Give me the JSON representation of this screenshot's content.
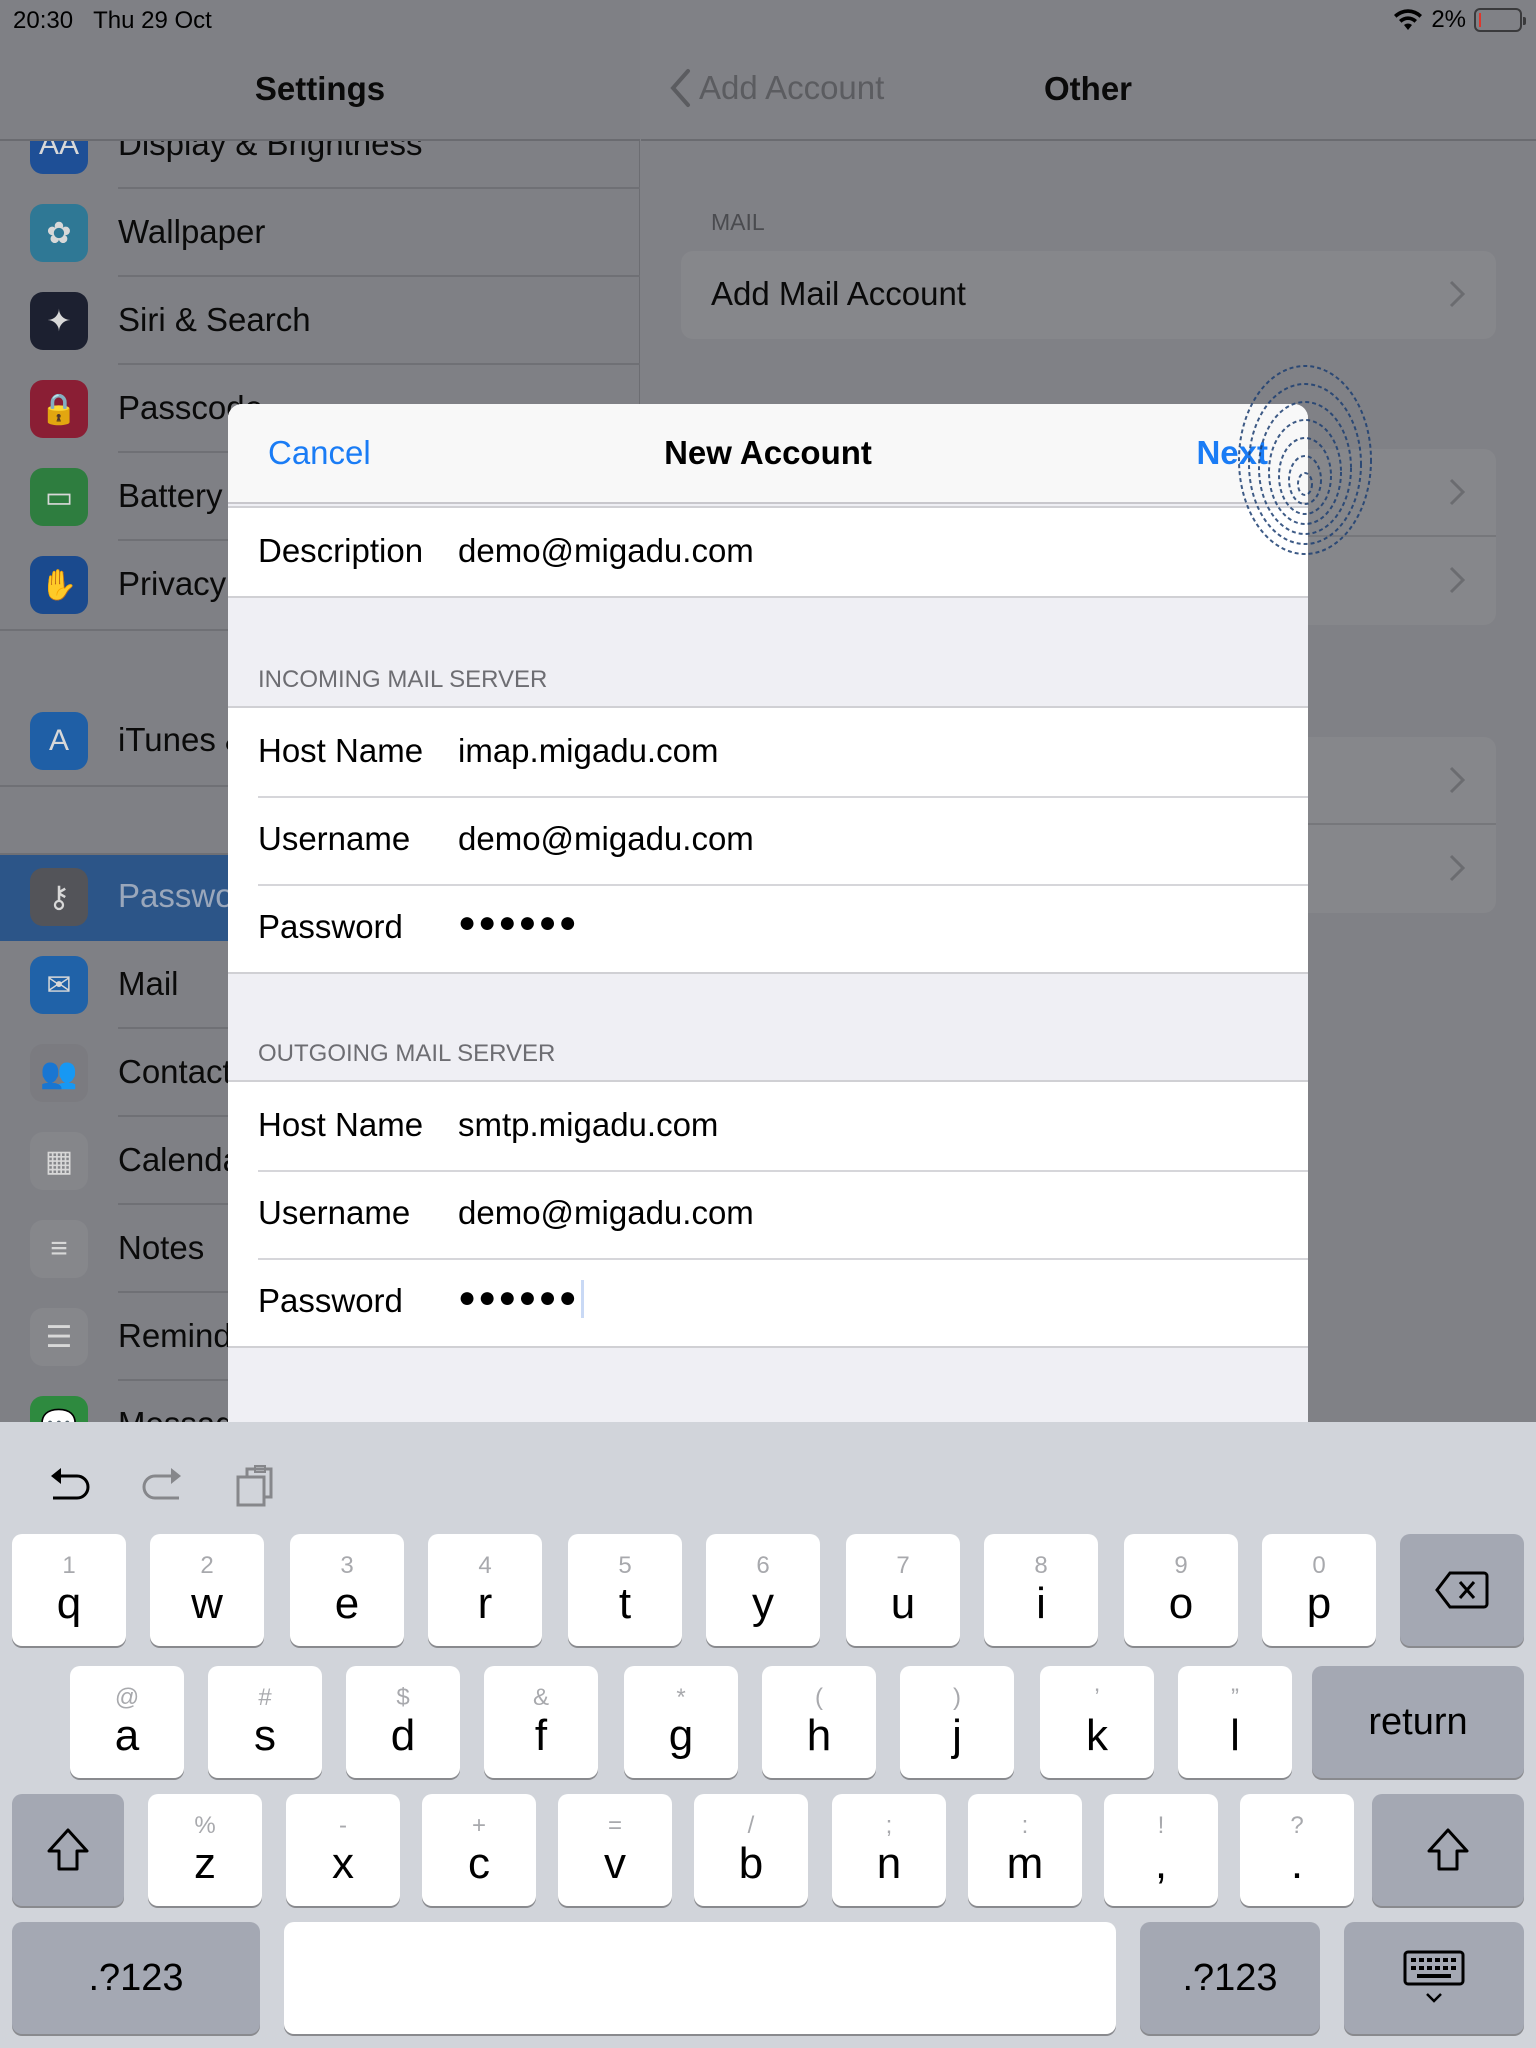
{
  "status_bar": {
    "time": "20:30",
    "date": "Thu 29 Oct",
    "battery": "2%",
    "battery_color": "#e0352b"
  },
  "settings": {
    "title": "Settings",
    "items": [
      {
        "label": "Display & Brightness",
        "icon": "display-brightness-icon",
        "color": "#1e4f96",
        "glyph": "AA"
      },
      {
        "label": "Wallpaper",
        "icon": "wallpaper-icon",
        "color": "#2f7895",
        "glyph": "✿"
      },
      {
        "label": "Siri & Search",
        "icon": "siri-icon",
        "color": "#1c2030",
        "glyph": "✦"
      },
      {
        "label": "Passcode",
        "icon": "lock-icon",
        "color": "#8a1e34",
        "glyph": "🔒"
      },
      {
        "label": "Battery",
        "icon": "battery-icon",
        "color": "#2e7d3f",
        "glyph": "▭"
      },
      {
        "label": "Privacy",
        "icon": "privacy-hand-icon",
        "color": "#1a4a8e",
        "glyph": "✋"
      },
      {
        "label": "iTunes & App Store",
        "icon": "app-store-icon",
        "color": "#1f5fa6",
        "glyph": "A"
      },
      {
        "label": "Passwords & Accounts",
        "icon": "key-icon",
        "color": "#535459",
        "glyph": "⚷",
        "selected": true
      },
      {
        "label": "Mail",
        "icon": "mail-icon",
        "color": "#2062a8",
        "glyph": "✉"
      },
      {
        "label": "Contacts",
        "icon": "contacts-icon",
        "color": "#7b7b80",
        "glyph": "👥"
      },
      {
        "label": "Calendar",
        "icon": "calendar-icon",
        "color": "#85868a",
        "glyph": "▦"
      },
      {
        "label": "Notes",
        "icon": "notes-icon",
        "color": "#86878b",
        "glyph": "≡"
      },
      {
        "label": "Reminders",
        "icon": "reminders-icon",
        "color": "#86878b",
        "glyph": "☰"
      },
      {
        "label": "Messages",
        "icon": "messages-icon",
        "color": "#2e8a3f",
        "glyph": "💬"
      }
    ]
  },
  "detail": {
    "back_label": "Add Account",
    "title": "Other",
    "section_mail": "MAIL",
    "add_mail_account": "Add Mail Account"
  },
  "modal": {
    "cancel": "Cancel",
    "title": "New Account",
    "next": "Next",
    "description_label": "Description",
    "description_value": "demo@migadu.com",
    "incoming_header": "INCOMING MAIL SERVER",
    "incoming": {
      "host_label": "Host Name",
      "host_value": "imap.migadu.com",
      "user_label": "Username",
      "user_value": "demo@migadu.com",
      "pass_label": "Password",
      "pass_value": "●●●●●●"
    },
    "outgoing_header": "OUTGOING MAIL SERVER",
    "outgoing": {
      "host_label": "Host Name",
      "host_value": "smtp.migadu.com",
      "user_label": "Username",
      "user_value": "demo@migadu.com",
      "pass_label": "Password",
      "pass_value": "●●●●●●"
    }
  },
  "keyboard": {
    "row1": [
      {
        "alt": "1",
        "main": "q"
      },
      {
        "alt": "2",
        "main": "w"
      },
      {
        "alt": "3",
        "main": "e"
      },
      {
        "alt": "4",
        "main": "r"
      },
      {
        "alt": "5",
        "main": "t"
      },
      {
        "alt": "6",
        "main": "y"
      },
      {
        "alt": "7",
        "main": "u"
      },
      {
        "alt": "8",
        "main": "i"
      },
      {
        "alt": "9",
        "main": "o"
      },
      {
        "alt": "0",
        "main": "p"
      }
    ],
    "row2": [
      {
        "alt": "@",
        "main": "a"
      },
      {
        "alt": "#",
        "main": "s"
      },
      {
        "alt": "$",
        "main": "d"
      },
      {
        "alt": "&",
        "main": "f"
      },
      {
        "alt": "*",
        "main": "g"
      },
      {
        "alt": "(",
        "main": "h"
      },
      {
        "alt": ")",
        "main": "j"
      },
      {
        "alt": "’",
        "main": "k"
      },
      {
        "alt": "”",
        "main": "l"
      }
    ],
    "row3": [
      {
        "alt": "%",
        "main": "z"
      },
      {
        "alt": "-",
        "main": "x"
      },
      {
        "alt": "+",
        "main": "c"
      },
      {
        "alt": "=",
        "main": "v"
      },
      {
        "alt": "/",
        "main": "b"
      },
      {
        "alt": ";",
        "main": "n"
      },
      {
        "alt": ":",
        "main": "m"
      },
      {
        "alt": "!",
        "main": ","
      },
      {
        "alt": "?",
        "main": "."
      }
    ],
    "return": "return",
    "numbers_left": ".?123",
    "numbers_right": ".?123"
  }
}
